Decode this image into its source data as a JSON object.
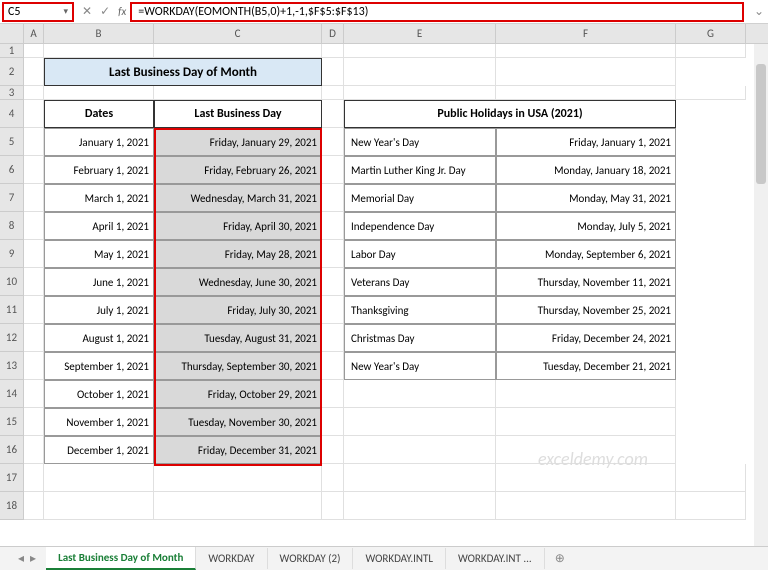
{
  "formula_bar": {
    "cell_ref": "C5",
    "formula": "=WORKDAY(EOMONTH(B5,0)+1,-1,$F$5:$F$13)"
  },
  "columns": [
    "A",
    "B",
    "C",
    "D",
    "E",
    "F",
    "G"
  ],
  "title": "Last Business Day of Month",
  "headers": {
    "dates": "Dates",
    "lbd": "Last Business Day",
    "holidays": "Public Holidays in USA (2021)"
  },
  "rows": [
    {
      "date": "January 1, 2021",
      "lbd": "Friday, January 29, 2021",
      "hname": "New Year's Day",
      "hdate": "Friday, January 1, 2021"
    },
    {
      "date": "February 1, 2021",
      "lbd": "Friday, February 26, 2021",
      "hname": "Martin Luther King Jr. Day",
      "hdate": "Monday, January 18, 2021"
    },
    {
      "date": "March 1, 2021",
      "lbd": "Wednesday, March 31, 2021",
      "hname": "Memorial Day",
      "hdate": "Monday, May 31, 2021"
    },
    {
      "date": "April 1, 2021",
      "lbd": "Friday, April 30, 2021",
      "hname": "Independence Day",
      "hdate": "Monday, July 5, 2021"
    },
    {
      "date": "May 1, 2021",
      "lbd": "Friday, May 28, 2021",
      "hname": "Labor Day",
      "hdate": "Monday, September 6, 2021"
    },
    {
      "date": "June 1, 2021",
      "lbd": "Wednesday, June 30, 2021",
      "hname": "Veterans Day",
      "hdate": "Thursday, November 11, 2021"
    },
    {
      "date": "July 1, 2021",
      "lbd": "Friday, July 30, 2021",
      "hname": "Thanksgiving",
      "hdate": "Thursday, November 25, 2021"
    },
    {
      "date": "August 1, 2021",
      "lbd": "Tuesday, August 31, 2021",
      "hname": "Christmas Day",
      "hdate": "Friday, December 24, 2021"
    },
    {
      "date": "September 1, 2021",
      "lbd": "Thursday, September 30, 2021",
      "hname": "New Year's Day",
      "hdate": "Tuesday, December 21, 2021"
    },
    {
      "date": "October 1, 2021",
      "lbd": "Friday, October 29, 2021"
    },
    {
      "date": "November 1, 2021",
      "lbd": "Tuesday, November 30, 2021"
    },
    {
      "date": "December 1, 2021",
      "lbd": "Friday, December 31, 2021"
    }
  ],
  "tabs": [
    "Last Business Day of Month",
    "WORKDAY",
    "WORKDAY (2)",
    "WORKDAY.INTL",
    "WORKDAY.INT ..."
  ],
  "watermark": "exceldemy.com"
}
